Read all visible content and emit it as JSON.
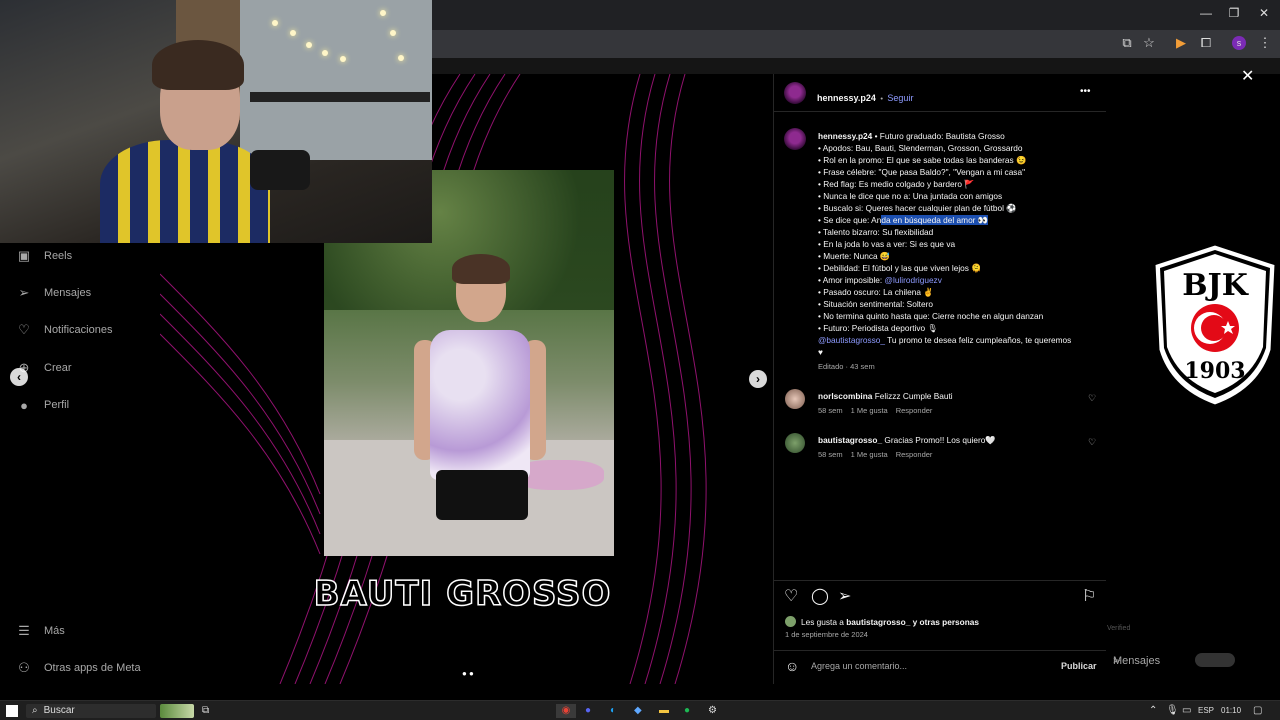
{
  "window": {
    "minimize": "—",
    "restore": "❐",
    "close": "✕"
  },
  "sidebar": {
    "items": [
      {
        "label": "Reels",
        "icon": "reels-icon"
      },
      {
        "label": "Mensajes",
        "icon": "messages-icon"
      },
      {
        "label": "Notificaciones",
        "icon": "heart-icon"
      },
      {
        "label": "Crear",
        "icon": "plus-icon"
      },
      {
        "label": "Perfil",
        "icon": "profile-icon"
      }
    ],
    "more": "Más",
    "meta_apps": "Otras apps de Meta"
  },
  "post": {
    "overlay_title": "BAUTI GROSSO",
    "close": "✕",
    "dots": "● ●"
  },
  "panel": {
    "header": {
      "username": "hennessy.p24",
      "separator": "•",
      "follow": "Seguir",
      "more": "•••"
    },
    "caption": {
      "username": "hennessy.p24",
      "line0": " • Futuro graduado: Bautista Grosso",
      "lines": [
        "• Apodos: Bau, Bauti, Slenderman, Grosson, Grossardo",
        "• Rol en la promo: El que se sabe todas las banderas 😉",
        "• Frase célebre: \"Que pasa Baldo?\", \"Vengan a mi casa\"",
        "• Red flag: Es medio colgado y bardero 🚩",
        "• Nunca le dice que no a: Una juntada con amigos",
        "• Buscalo si: Queres hacer cualquier plan de fútbol ⚽"
      ],
      "line_hl_pre": "• Se dice que: An",
      "line_hl": "da en búsqueda del amor 👀",
      "lines2": [
        "• Talento bizarro: Su flexibilidad",
        "• En la joda lo vas a ver: Si es que va",
        "• Muerte: Nunca 😅",
        "• Debilidad: El fútbol y las que viven lejos 🫠"
      ],
      "amor_pre": "• Amor imposible: ",
      "amor_mention": "@lulirodriguezv",
      "lines3": [
        "• Pasado oscuro: La chilena ✌",
        "• Situación sentimental: Soltero",
        "• No termina quinto hasta que: Cierre noche en algun danzan",
        "• Futuro: Periodista deportivo 🎙"
      ],
      "end_mention": "@bautistagrosso_",
      "end_text": " Tu promo te desea feliz cumpleaños, te queremos",
      "end_heart": "♥",
      "edited": "Editado · 43 sem"
    },
    "comments": [
      {
        "user": "norlscombina",
        "text": " Felizzz Cumple Bauti",
        "time": "58 sem",
        "likes": "1 Me gusta",
        "reply": "Responder"
      },
      {
        "user": "bautistagrosso_",
        "text": " Gracias Promo!! Los quiero🤍",
        "time": "58 sem",
        "likes": "1 Me gusta",
        "reply": "Responder"
      }
    ],
    "likes_prefix": "Les gusta a ",
    "likes_user": "bautistagrosso_",
    "likes_suffix": " y otras personas",
    "date": "1 de septiembre de 2024",
    "comment_placeholder": "Agrega un comentario...",
    "publish": "Publicar"
  },
  "background": {
    "messages": "Mensajes",
    "verified": "Verified"
  },
  "bjk": {
    "letters": "BJK",
    "year": "1903"
  },
  "taskbar": {
    "search": "Buscar",
    "lang": "ESP",
    "time": "01:10"
  }
}
